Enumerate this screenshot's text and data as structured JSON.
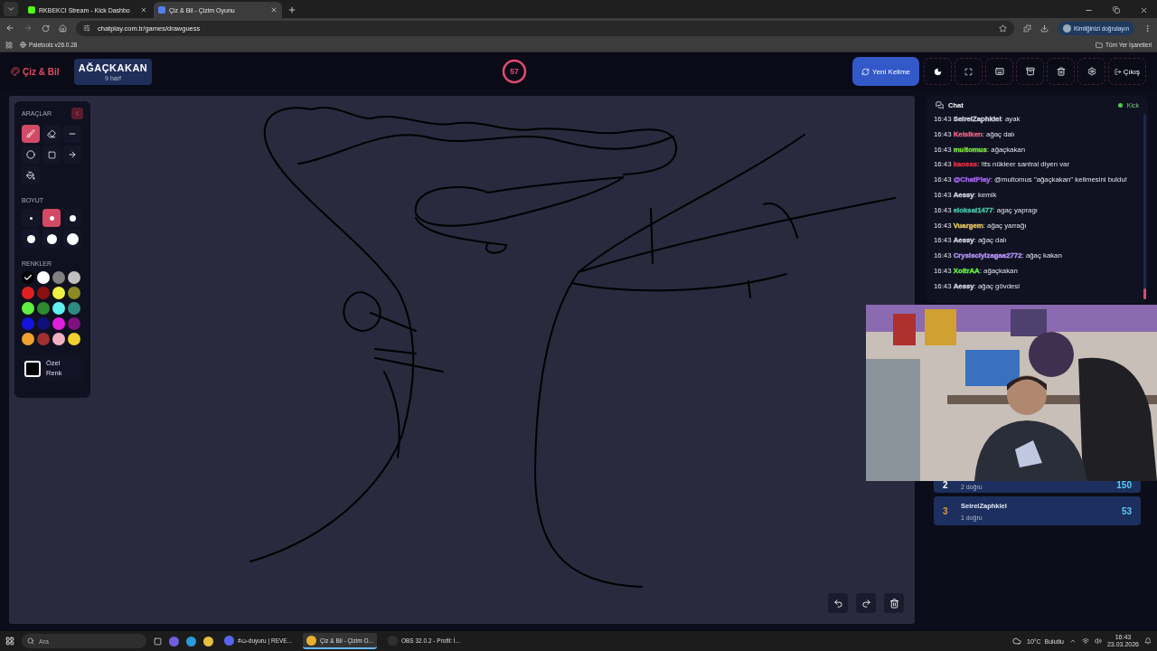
{
  "browser": {
    "tabs": [
      {
        "title": "RKBEKCI Stream - Kick Dashbo",
        "kind": "kick",
        "selected": false
      },
      {
        "title": "Çiz & Bil - Çizim Oyunu",
        "kind": "chatplay",
        "selected": true
      }
    ],
    "url": "chatplay.com.tr/games/drawguess",
    "profile_button": "Kimliğinizi doğrulayın",
    "bookmark": "Paletools v26.0.28",
    "bookmarks_folder": "Tüm Yer İşaretleri"
  },
  "header": {
    "logo": "Çiz & Bil",
    "word": "AĞAÇKAKAN",
    "word_hint": "9 harf",
    "timer": {
      "text": "57"
    },
    "buttons": [
      {
        "kind": "refresh",
        "label": "Yeni Kelime"
      },
      {
        "kind": "moon"
      },
      {
        "kind": "fullscreen"
      },
      {
        "kind": "keyboard"
      },
      {
        "kind": "box"
      },
      {
        "kind": "trash"
      },
      {
        "kind": "settings"
      },
      {
        "kind": "exit",
        "label": "Çıkış"
      }
    ]
  },
  "tools": {
    "title": "ARAÇLAR",
    "items": [
      {
        "kind": "brush",
        "selected": true
      },
      {
        "kind": "eraser",
        "selected": false
      },
      {
        "kind": "line",
        "selected": false
      },
      {
        "kind": "circle",
        "selected": false
      },
      {
        "kind": "square",
        "selected": false
      },
      {
        "kind": "arrow",
        "selected": false
      },
      {
        "kind": "fill",
        "selected": false
      }
    ],
    "size_title": "BOYUT",
    "sizes": [
      {
        "selected": false
      },
      {
        "selected": true
      },
      {
        "selected": false
      },
      {
        "selected": false
      },
      {
        "selected": false
      },
      {
        "selected": false
      }
    ],
    "colors_title": "RENKLER",
    "colors": [
      {
        "color": "#000000",
        "selected": true
      },
      {
        "color": "#ffffff",
        "selected": false
      },
      {
        "color": "#808080",
        "selected": false
      },
      {
        "color": "#c0c0c0",
        "selected": false
      },
      {
        "color": "#e02020",
        "selected": false
      },
      {
        "color": "#8b1010",
        "selected": false
      },
      {
        "color": "#f0f040",
        "selected": false
      },
      {
        "color": "#8a8a20",
        "selected": false
      },
      {
        "color": "#60f040",
        "selected": false
      },
      {
        "color": "#2e8a2e",
        "selected": false
      },
      {
        "color": "#60f0f0",
        "selected": false
      },
      {
        "color": "#2e8a84",
        "selected": false
      },
      {
        "color": "#1414e0",
        "selected": false
      },
      {
        "color": "#10107a",
        "selected": false
      },
      {
        "color": "#e020e0",
        "selected": false
      },
      {
        "color": "#801080",
        "selected": false
      },
      {
        "color": "#f0a030",
        "selected": false
      },
      {
        "color": "#a03030",
        "selected": false
      },
      {
        "color": "#f0b0c0",
        "selected": false
      },
      {
        "color": "#f0d030",
        "selected": false
      }
    ],
    "custom_color": "Özel Renk"
  },
  "canvas_controls": [
    {
      "kind": "undo"
    },
    {
      "kind": "redo"
    },
    {
      "kind": "trash"
    }
  ],
  "chat": {
    "title": "Chat",
    "source": {
      "label": "Kick",
      "color": "#44cc44"
    },
    "separator": ":",
    "messages": [
      {
        "time": "16:43",
        "user": "SeireiZaphkiel",
        "color": "#d0d0dc",
        "text": "ayak"
      },
      {
        "time": "16:43",
        "user": "Kelsiken",
        "color": "#e06080",
        "text": "ağaç dalı"
      },
      {
        "time": "16:43",
        "user": "multomus",
        "color": "#7ae040",
        "text": "ağaçkakan"
      },
      {
        "time": "16:43",
        "user": "kaosss",
        "color": "#e03040",
        "text": "!tts nükleer santral diyen var"
      },
      {
        "time": "16:43",
        "user": "@ChatPlay",
        "color": "#a060f0",
        "text": "@multomus \"ağaçkakan\" kelimesini buldu!"
      },
      {
        "time": "16:43",
        "user": "Aessy",
        "color": "#d0d0dc",
        "text": "kemik"
      },
      {
        "time": "16:43",
        "user": "eloksal1477",
        "color": "#40c0a0",
        "text": "agaç yapragı"
      },
      {
        "time": "16:43",
        "user": "Vuargem",
        "color": "#e0c060",
        "text": "ağaç yarrağı"
      },
      {
        "time": "16:43",
        "user": "Aessy",
        "color": "#d0d0dc",
        "text": "ağaç dalı"
      },
      {
        "time": "16:43",
        "user": "Crysisciyizagaa2772",
        "color": "#b090f0",
        "text": "ağaç kakan"
      },
      {
        "time": "16:43",
        "user": "XoltrAA",
        "color": "#60f040",
        "text": "ağaçkakan"
      },
      {
        "time": "16:43",
        "user": "Aessy",
        "color": "#d0d0dc",
        "text": "ağaç gövdesi"
      }
    ]
  },
  "leaderboard": [
    {
      "rank": "2",
      "color": "#ffffff",
      "detail": "2 doğru",
      "score": "150"
    },
    {
      "rank": "3",
      "name": "SeireiZaphkiel",
      "color": "#e0963c",
      "detail": "1 doğru",
      "score": "53"
    }
  ],
  "taskbar": {
    "search_placeholder": "Ara",
    "apps": [
      {
        "label": "#ꞷ-duyuru | REVE...",
        "kind": "discord",
        "selected": false
      },
      {
        "label": "Çiz & Bil - Çizim O...",
        "kind": "chrome",
        "selected": true
      },
      {
        "label": "OBS 32.0.2 - Profil: İ...",
        "kind": "obs",
        "selected": false
      }
    ],
    "weather": "10°C  Bulutlu",
    "time": "16:43",
    "date": "23.03.2026"
  }
}
